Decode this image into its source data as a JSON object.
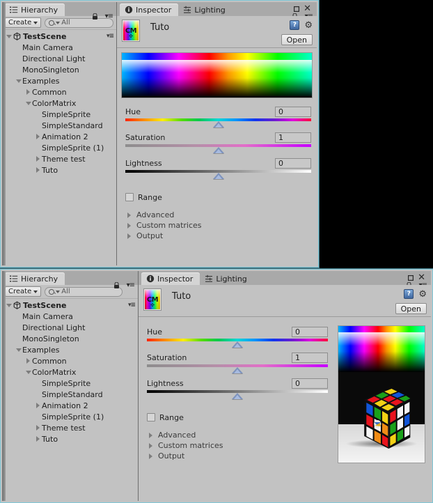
{
  "window_top": {
    "controls": {
      "restore": "▫",
      "close": "✕",
      "lock": "🔒",
      "menu": "▾≡"
    },
    "hierarchy": {
      "tab_label": "Hierarchy",
      "tab_icon": "hierarchy-icon",
      "create_label": "Create",
      "search_placeholder": "All",
      "search_value": "",
      "scene_name": "TestScene",
      "items": [
        {
          "label": "Main Camera",
          "depth": 1,
          "toggle": "none"
        },
        {
          "label": "Directional Light",
          "depth": 1,
          "toggle": "none"
        },
        {
          "label": "MonoSingleton",
          "depth": 1,
          "toggle": "none"
        },
        {
          "label": "Examples",
          "depth": 1,
          "toggle": "open"
        },
        {
          "label": "Common",
          "depth": 2,
          "toggle": "closed"
        },
        {
          "label": "ColorMatrix",
          "depth": 2,
          "toggle": "open"
        },
        {
          "label": "SimpleSprite",
          "depth": 3,
          "toggle": "none"
        },
        {
          "label": "SimpleStandard",
          "depth": 3,
          "toggle": "none"
        },
        {
          "label": "Animation 2",
          "depth": 3,
          "toggle": "closed"
        },
        {
          "label": "SimpleSprite (1)",
          "depth": 3,
          "toggle": "none"
        },
        {
          "label": "Theme test",
          "depth": 3,
          "toggle": "closed"
        },
        {
          "label": "Tuto",
          "depth": 3,
          "toggle": "closed"
        }
      ]
    },
    "inspector": {
      "tabs": [
        {
          "label": "Inspector",
          "icon": "info-icon",
          "active": true
        },
        {
          "label": "Lighting",
          "icon": "lighting-icon",
          "active": false
        }
      ],
      "component_icon_label": "CM",
      "object_name": "Tuto",
      "help_icon": "help-book-icon",
      "gear_icon": "gear-icon",
      "open_label": "Open",
      "preview_name": "hue-gradient-preview",
      "sliders": [
        {
          "name": "Hue",
          "value": "0",
          "track": "hue",
          "handle_pct": 50
        },
        {
          "name": "Saturation",
          "value": "1",
          "track": "sat",
          "handle_pct": 50
        },
        {
          "name": "Lightness",
          "value": "0",
          "track": "light",
          "handle_pct": 50
        }
      ],
      "range_label": "Range",
      "range_checked": false,
      "foldouts": [
        "Advanced",
        "Custom matrices",
        "Output"
      ]
    }
  },
  "window_bottom": {
    "controls": {
      "restore": "▫",
      "close": "✕",
      "lock": "🔒",
      "menu": "▾≡"
    },
    "hierarchy": {
      "tab_label": "Hierarchy",
      "tab_icon": "hierarchy-icon",
      "create_label": "Create",
      "search_placeholder": "All",
      "search_value": "",
      "scene_name": "TestScene",
      "items": [
        {
          "label": "Main Camera",
          "depth": 1,
          "toggle": "none"
        },
        {
          "label": "Directional Light",
          "depth": 1,
          "toggle": "none"
        },
        {
          "label": "MonoSingleton",
          "depth": 1,
          "toggle": "none"
        },
        {
          "label": "Examples",
          "depth": 1,
          "toggle": "open"
        },
        {
          "label": "Common",
          "depth": 2,
          "toggle": "closed"
        },
        {
          "label": "ColorMatrix",
          "depth": 2,
          "toggle": "open"
        },
        {
          "label": "SimpleSprite",
          "depth": 3,
          "toggle": "none"
        },
        {
          "label": "SimpleStandard",
          "depth": 3,
          "toggle": "none"
        },
        {
          "label": "Animation 2",
          "depth": 3,
          "toggle": "closed"
        },
        {
          "label": "SimpleSprite (1)",
          "depth": 3,
          "toggle": "none"
        },
        {
          "label": "Theme test",
          "depth": 3,
          "toggle": "closed"
        },
        {
          "label": "Tuto",
          "depth": 3,
          "toggle": "closed"
        }
      ]
    },
    "inspector": {
      "tabs": [
        {
          "label": "Inspector",
          "icon": "info-icon",
          "active": true
        },
        {
          "label": "Lighting",
          "icon": "lighting-icon",
          "active": false
        }
      ],
      "component_icon_label": "CM",
      "object_name": "Tuto",
      "help_icon": "help-book-icon",
      "gear_icon": "gear-icon",
      "open_label": "Open",
      "preview_name": "rubiks-cube-preview",
      "sliders": [
        {
          "name": "Hue",
          "value": "0",
          "track": "hue",
          "handle_pct": 50
        },
        {
          "name": "Saturation",
          "value": "1",
          "track": "sat",
          "handle_pct": 50
        },
        {
          "name": "Lightness",
          "value": "0",
          "track": "light",
          "handle_pct": 50
        }
      ],
      "range_label": "Range",
      "range_checked": false,
      "foldouts": [
        "Advanced",
        "Custom matrices",
        "Output"
      ]
    }
  },
  "colors": {
    "panel_bg": "#c2c2c2",
    "chrome_bg": "#a9a9a9",
    "tab_active": "#d4d4d4",
    "window_border": "#7ec8d8",
    "handle_fill": "#7e93bd",
    "desktop": "#000000"
  }
}
